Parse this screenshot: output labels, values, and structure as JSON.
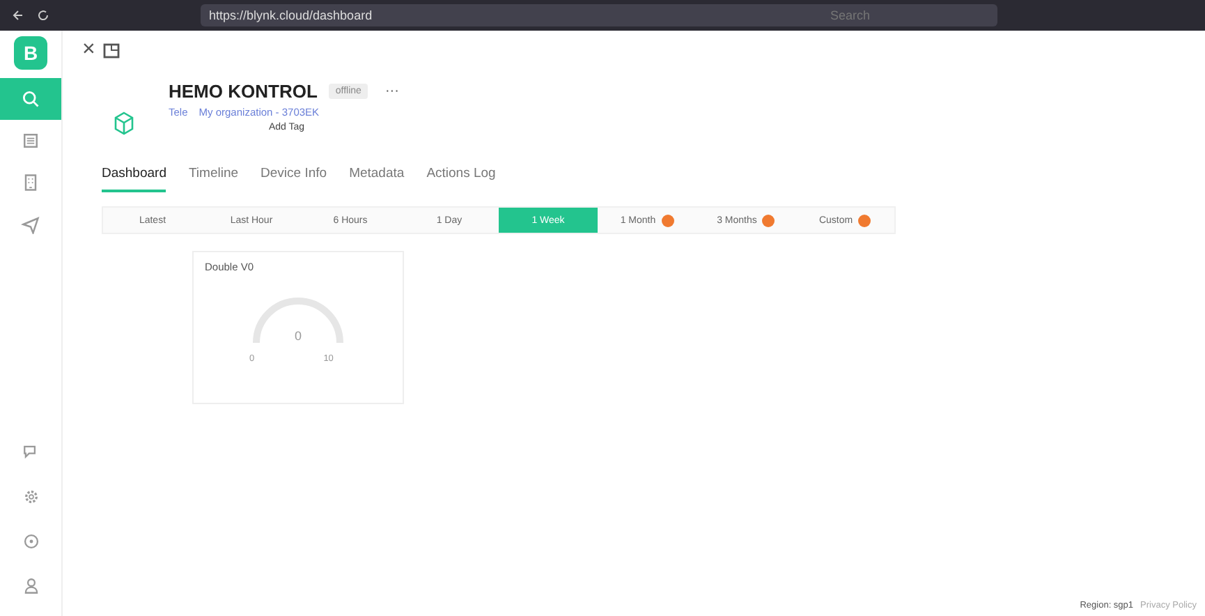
{
  "browser": {
    "url": "https://blynk.cloud/dashboard",
    "search_placeholder": "Search"
  },
  "sidebar": {
    "logo": "B",
    "items": [
      {
        "selected": true
      },
      {
        "selected": false
      },
      {
        "selected": false
      },
      {
        "selected": false
      }
    ]
  },
  "header": {
    "close": "×"
  },
  "device": {
    "name": "HEMO KONTROL",
    "status": "offline",
    "more": "···",
    "owner": "Tele",
    "organization": "My organization - 3703EK",
    "add_tag": "Add Tag"
  },
  "tabs": [
    {
      "label": "Dashboard",
      "selected": true
    },
    {
      "label": "Timeline",
      "selected": false
    },
    {
      "label": "Device Info",
      "selected": false
    },
    {
      "label": "Metadata",
      "selected": false
    },
    {
      "label": "Actions Log",
      "selected": false
    }
  ],
  "ranges": [
    {
      "label": "Latest",
      "selected": false,
      "locked": false
    },
    {
      "label": "Last Hour",
      "selected": false,
      "locked": false
    },
    {
      "label": "6 Hours",
      "selected": false,
      "locked": false
    },
    {
      "label": "1 Day",
      "selected": false,
      "locked": false
    },
    {
      "label": "1 Week",
      "selected": true,
      "locked": false
    },
    {
      "label": "1 Month",
      "selected": false,
      "locked": true
    },
    {
      "label": "3 Months",
      "selected": false,
      "locked": true
    },
    {
      "label": "Custom",
      "selected": false,
      "locked": true
    }
  ],
  "widgets": [
    {
      "kind": "gauge",
      "title": "Double V0",
      "value": "0",
      "min": "0",
      "max": "10"
    }
  ],
  "footer": {
    "region": "Region: sgp1",
    "privacy": "Privacy Policy"
  }
}
